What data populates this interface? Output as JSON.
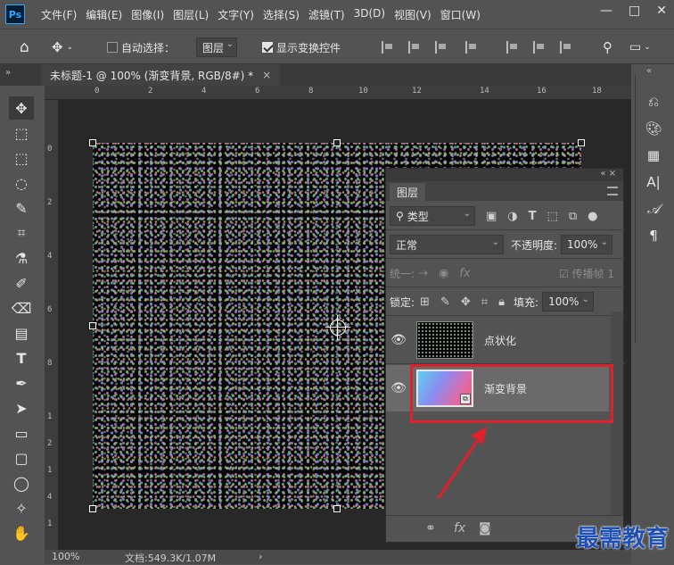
{
  "app": {
    "logo": "Ps"
  },
  "menu": [
    "文件(F)",
    "编辑(E)",
    "图像(I)",
    "图层(L)",
    "文字(Y)",
    "选择(S)",
    "滤镜(T)",
    "3D(D)",
    "视图(V)",
    "窗口(W)"
  ],
  "window_controls": {
    "minimize": "—",
    "restore": "□",
    "close": "✕"
  },
  "options": {
    "auto_select_label": "自动选择：",
    "auto_select_checked": false,
    "auto_select_target": "图层",
    "show_transform_label": "显示变换控件",
    "show_transform_checked": true
  },
  "document_tab": {
    "title": "未标题-1 @ 100% (渐变背景, RGB/8#) *",
    "close": "×"
  },
  "ruler_top": [
    "0",
    "2",
    "4",
    "6",
    "8",
    "10",
    "12",
    "14",
    "16",
    "18"
  ],
  "ruler_left": [
    "0",
    "2",
    "4",
    "6",
    "8",
    "1",
    "2",
    "1",
    "4",
    "1"
  ],
  "status": {
    "zoom": "100%",
    "doc_info": "文档:549.3K/1.07M",
    "arrow": "›"
  },
  "layers_panel": {
    "header_controls": "« ×",
    "tab": "图层",
    "filter_kind": "类型",
    "blend_mode": "正常",
    "opacity_label": "不透明度:",
    "opacity_value": "100%",
    "unify_label": "统一:",
    "propagate_label": "传播帧 1",
    "lock_label": "锁定:",
    "fill_label": "填充:",
    "fill_value": "100%",
    "layers": [
      {
        "name": "点状化",
        "visible": true,
        "selected": false
      },
      {
        "name": "渐变背景",
        "visible": true,
        "selected": true
      }
    ],
    "footer": {
      "link": "⚭",
      "fx": "fx",
      "mask": "◙"
    }
  },
  "annotation": {
    "highlight_color": "#e0202a"
  },
  "watermark": "最需教育"
}
